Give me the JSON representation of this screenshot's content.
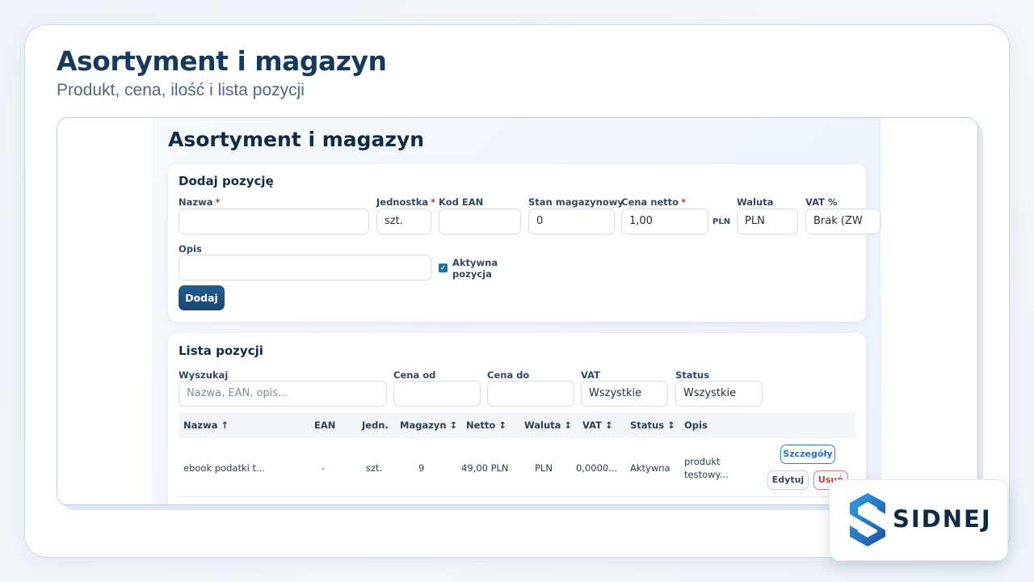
{
  "slide": {
    "title": "Asortyment i magazyn",
    "subtitle": "Produkt, cena, ilość i lista pozycji"
  },
  "app": {
    "title": "Asortyment i magazyn",
    "add_form": {
      "heading": "Dodaj pozycję",
      "fields": {
        "name": {
          "label": "Nazwa",
          "required": "*",
          "value": ""
        },
        "unit": {
          "label": "Jednostka",
          "required": "*",
          "value": "szt."
        },
        "ean": {
          "label": "Kod EAN",
          "value": ""
        },
        "stock": {
          "label": "Stan magazynowy",
          "value": "0"
        },
        "price": {
          "label": "Cena netto",
          "required": "*",
          "value": "1,00",
          "suffix": "PLN"
        },
        "currency": {
          "label": "Waluta",
          "value": "PLN"
        },
        "vat": {
          "label": "VAT %",
          "value": "Brak (ZW"
        },
        "description": {
          "label": "Opis",
          "value": ""
        }
      },
      "active_checkbox": {
        "label": "Aktywna pozycja",
        "checked": true
      },
      "submit_label": "Dodaj"
    },
    "list": {
      "heading": "Lista pozycji",
      "filters": {
        "search": {
          "label": "Wyszukaj",
          "placeholder": "Nazwa, EAN, opis..."
        },
        "price_from": {
          "label": "Cena od",
          "value": ""
        },
        "price_to": {
          "label": "Cena do",
          "value": ""
        },
        "vat": {
          "label": "VAT",
          "value": "Wszystkie"
        },
        "status": {
          "label": "Status",
          "value": "Wszystkie"
        }
      },
      "columns": [
        "Nazwa ↑",
        "EAN",
        "Jedn.",
        "Magazyn ↕",
        "Netto ↕",
        "Waluta ↕",
        "VAT ↕",
        "Status ↕",
        "Opis"
      ],
      "rows": [
        {
          "name": "ebook podatki t...",
          "ean": "-",
          "unit": "szt.",
          "stock": "9",
          "net": "49,00 PLN",
          "currency": "PLN",
          "vat": "0,0000...",
          "status": "Aktywna",
          "description_line1": "produkt",
          "description_line2": "testowy...",
          "actions": {
            "details": "Szczegóły",
            "edit": "Edytuj",
            "delete": "Usuń"
          }
        }
      ]
    }
  },
  "brand": {
    "name": "SIDNEJ",
    "logo_icon": "sidnej-s-hexagon-icon"
  },
  "colors": {
    "accent": "#1f5f94",
    "title": "#163a5f",
    "danger": "#d33b3b"
  }
}
